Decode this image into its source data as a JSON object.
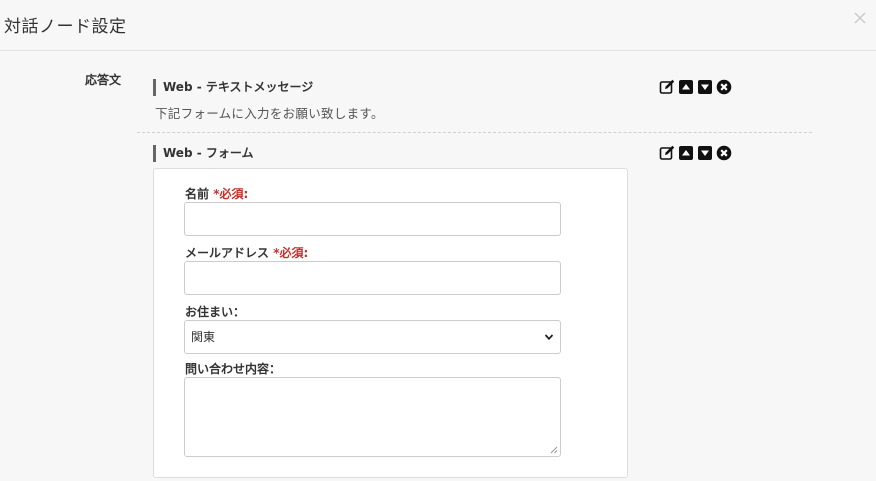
{
  "modal": {
    "title": "対話ノード設定",
    "close_icon": "close-icon"
  },
  "response": {
    "label": "応答文",
    "blocks": [
      {
        "title": "Web - テキストメッセージ",
        "text": "下記フォームに入力をお願い致します。",
        "tools": [
          "edit-icon",
          "move-up-icon",
          "move-down-icon",
          "delete-icon"
        ]
      },
      {
        "title": "Web - フォーム",
        "tools": [
          "edit-icon",
          "move-up-icon",
          "move-down-icon",
          "delete-icon"
        ],
        "form": {
          "name_label": "名前",
          "name_required": "*必須:",
          "name_value": "",
          "email_label": "メールアドレス",
          "email_required": "*必須:",
          "email_value": "",
          "residence_label": "お住まい：",
          "residence_selected": "関東",
          "inquiry_label": "問い合わせ内容：",
          "inquiry_value": ""
        }
      }
    ]
  },
  "colors": {
    "required": "#c9302c",
    "background": "#f7f7f7"
  }
}
